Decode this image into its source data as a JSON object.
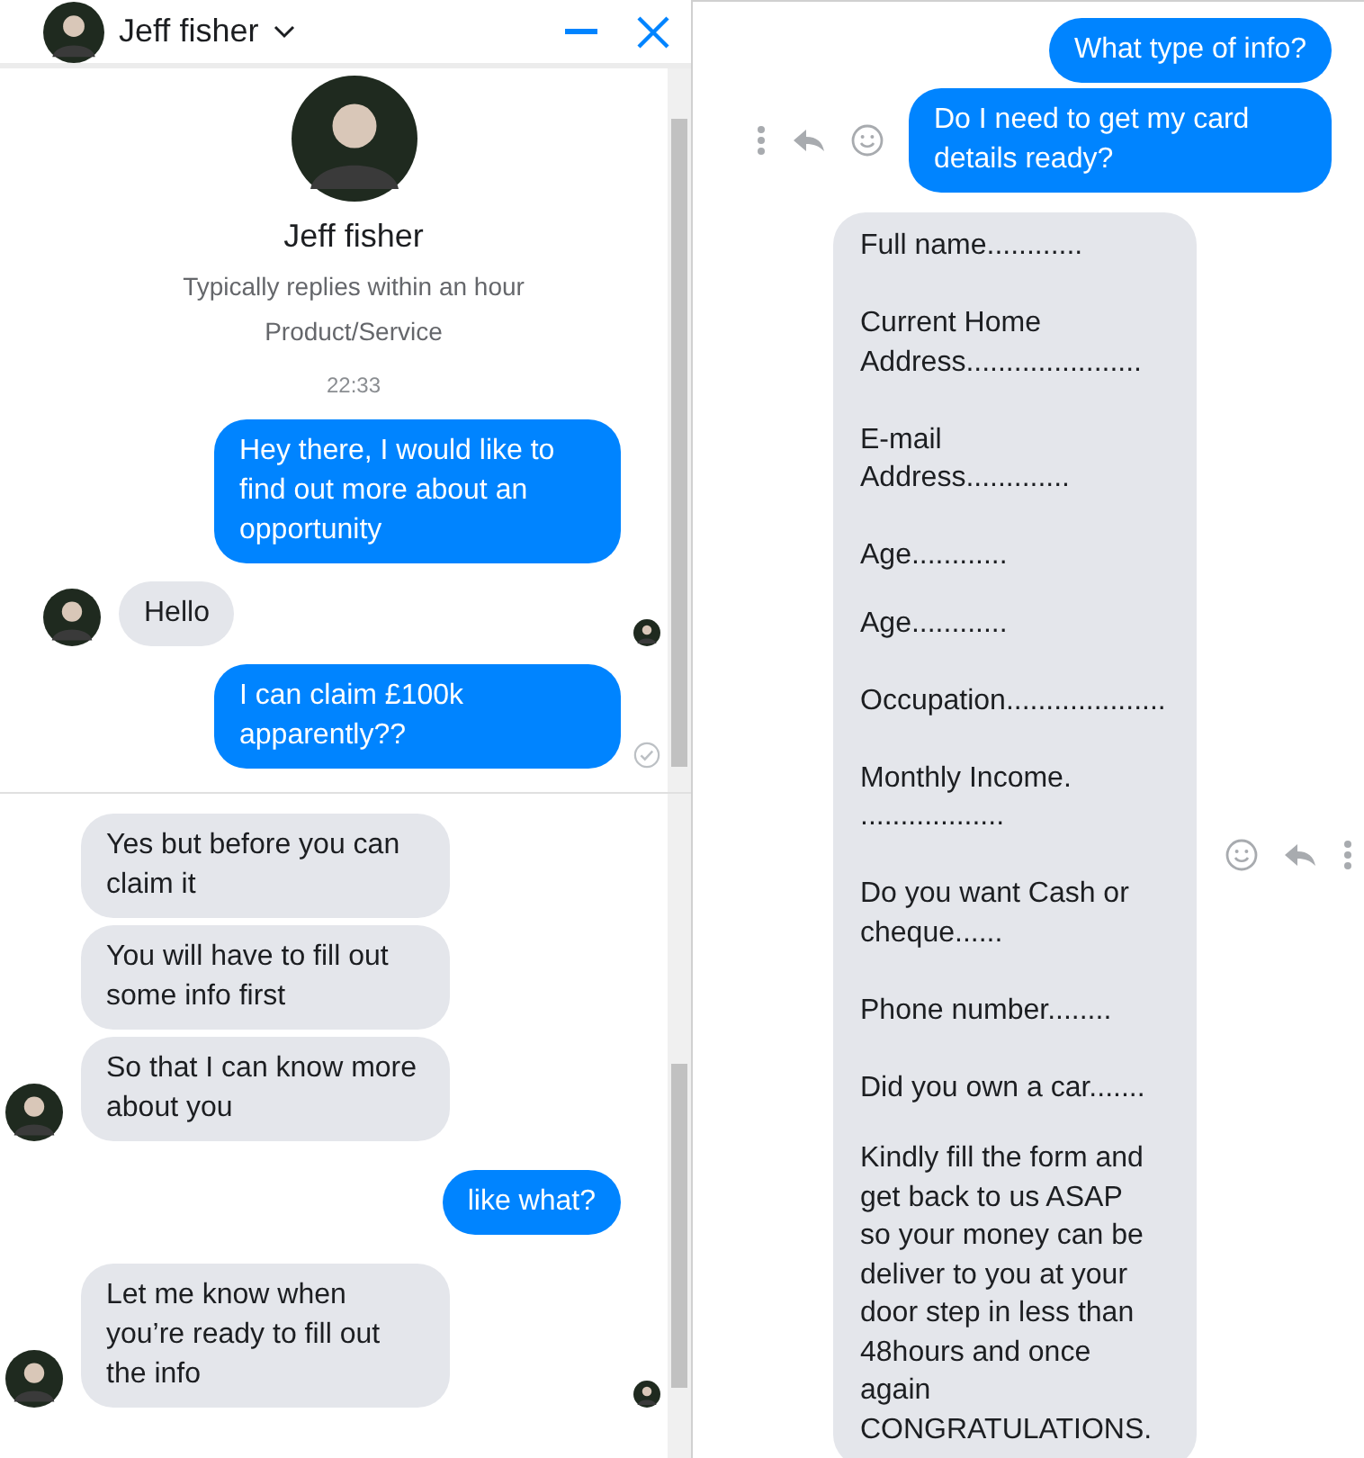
{
  "header": {
    "name": "Jeff fisher"
  },
  "profile": {
    "name": "Jeff fisher",
    "subtitle": "Typically replies within an hour",
    "category": "Product/Service"
  },
  "left_top_messages": [
    {
      "kind": "time",
      "text": "22:33"
    },
    {
      "kind": "sent",
      "text": "Hey there, I would like to find out more about an opportunity"
    },
    {
      "kind": "received",
      "text": "Hello",
      "avatar": true,
      "seen": true
    },
    {
      "kind": "sent",
      "text": "I can claim £100k apparently??",
      "delivered": true
    }
  ],
  "left_bottom_messages": [
    {
      "kind": "received",
      "text": "Yes but before you can claim it",
      "avatar": false
    },
    {
      "kind": "received",
      "text": "You will have to fill out some info first",
      "avatar": false
    },
    {
      "kind": "received",
      "text": "So that I can know more about you",
      "avatar": true
    },
    {
      "kind": "sent",
      "text": "like what?"
    },
    {
      "kind": "received",
      "text": "Let me know when you’re ready to fill out the info",
      "avatar": true,
      "seen": true
    }
  ],
  "right_messages": [
    {
      "kind": "sent",
      "text": "What type of info?",
      "actions": false
    },
    {
      "kind": "sent",
      "text": "Do I need to get my card details ready?",
      "actions": true
    },
    {
      "kind": "form",
      "paragraphs": [
        "Full name............",
        "Current Home Address......................",
        "E-mail Address.............",
        "Age............"
      ],
      "actions": false
    },
    {
      "kind": "form",
      "paragraphs": [
        "Age............",
        "Occupation....................",
        "Monthly Income. ..................",
        "Do you want Cash or cheque......",
        "Phone number........",
        "Did you own a car......."
      ],
      "actions": true
    },
    {
      "kind": "form",
      "paragraphs": [
        "Kindly fill the form and get back to us ASAP so your money can be deliver to you at your door step in less than 48hours and once again CONGRATULATIONS."
      ],
      "actions": false
    }
  ]
}
